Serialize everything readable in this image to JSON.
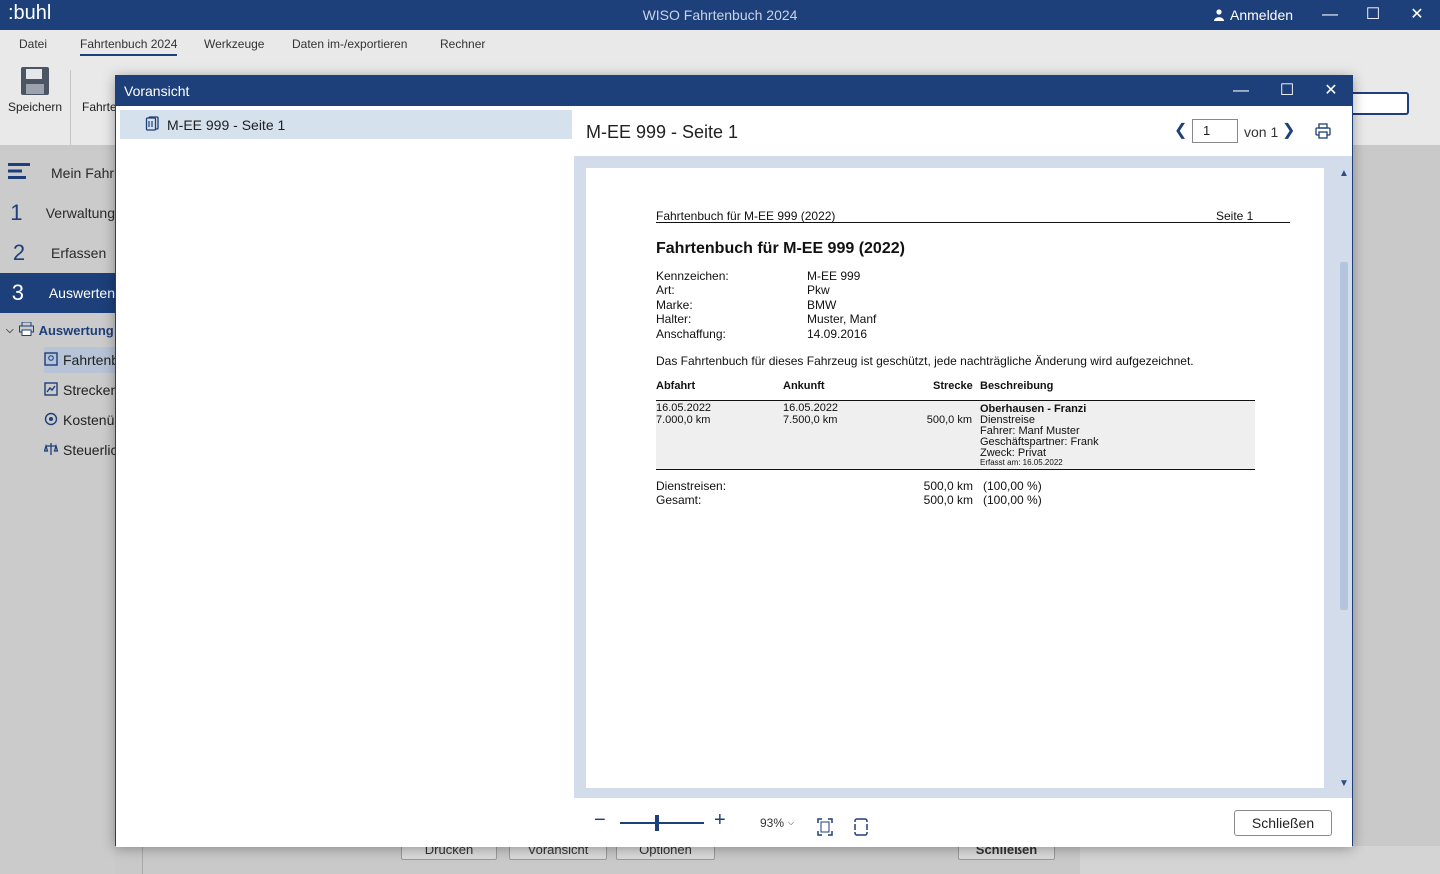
{
  "app": {
    "logo": ":buhl",
    "title": "WISO Fahrtenbuch 2024",
    "login_label": "Anmelden"
  },
  "menu": [
    "Datei",
    "Fahrtenbuch 2024",
    "Werkzeuge",
    "Daten im-/exportieren",
    "Rechner"
  ],
  "ribbon": {
    "save_label": "Speichern",
    "second_label": "Fahrte"
  },
  "nav": {
    "items": [
      {
        "num": "",
        "label": "Mein Fahr"
      },
      {
        "num": "1",
        "label": "Verwaltung"
      },
      {
        "num": "2",
        "label": "Erfassen"
      },
      {
        "num": "3",
        "label": "Auswerten"
      }
    ],
    "group_label": "Auswertung",
    "subitems": [
      "Fahrtenb",
      "Strecken",
      "Kostenü",
      "Steuerlic"
    ]
  },
  "background_buttons": [
    "Drucken",
    "Voransicht",
    "Optionen",
    "Schließen"
  ],
  "dialog": {
    "title": "Voransicht",
    "tree_item": "M-EE 999 - Seite 1",
    "preview_title": "M-EE 999 - Seite 1",
    "page_value": "1",
    "page_of": "von 1",
    "zoom_label": "93%",
    "zoom_level_percent": 93,
    "close_label": "Schließen"
  },
  "document": {
    "header_left": "Fahrtenbuch für M-EE 999 (2022)",
    "header_right": "Seite 1",
    "heading": "Fahrtenbuch für M-EE 999 (2022)",
    "fields": [
      {
        "label": "Kennzeichen:",
        "value": "M-EE 999"
      },
      {
        "label": "Art:",
        "value": "Pkw"
      },
      {
        "label": "Marke:",
        "value": "BMW"
      },
      {
        "label": "Halter:",
        "value": "Muster, Manf"
      },
      {
        "label": "Anschaffung:",
        "value": "14.09.2016"
      }
    ],
    "notice": "Das Fahrtenbuch für dieses Fahrzeug ist geschützt, jede nachträgliche Änderung wird aufgezeichnet.",
    "columns": [
      "Abfahrt",
      "Ankunft",
      "Strecke",
      "Beschreibung"
    ],
    "row": {
      "departure_date": "16.05.2022",
      "departure_km": "7.000,0 km",
      "arrival_date": "16.05.2022",
      "arrival_km": "7.500,0 km",
      "distance": "500,0 km",
      "route": "Oberhausen - Franzi",
      "type": "Dienstreise",
      "driver": "Fahrer: Manf Muster",
      "partner": "Geschäftspartner: Frank",
      "purpose": "Zweck: Privat",
      "recorded": "Erfasst am: 16.05.2022"
    },
    "summary": [
      {
        "label": "Dienstreisen:",
        "km": "500,0 km",
        "pct": "(100,00 %)"
      },
      {
        "label": "Gesamt:",
        "km": "500,0 km",
        "pct": "(100,00 %)"
      }
    ]
  }
}
